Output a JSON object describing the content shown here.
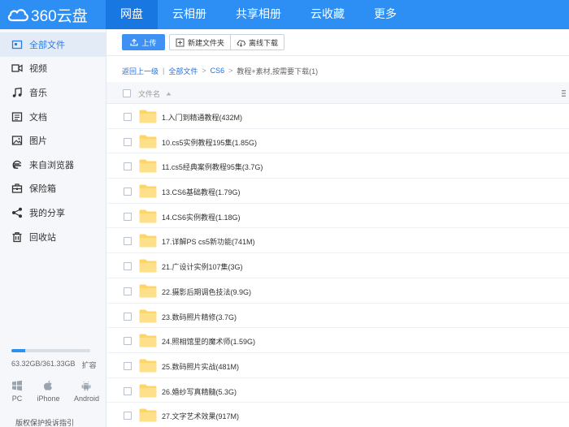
{
  "colors": {
    "accent": "#2d8ff3",
    "folder": "#ffd567"
  },
  "header": {
    "logo_text": "360云盘",
    "nav": [
      {
        "label": "网盘",
        "active": true
      },
      {
        "label": "云相册",
        "active": false
      },
      {
        "label": "共享相册",
        "active": false
      },
      {
        "label": "云收藏",
        "active": false
      },
      {
        "label": "更多",
        "active": false
      }
    ]
  },
  "sidebar": {
    "items": [
      {
        "label": "全部文件",
        "icon": "all-files-icon",
        "active": true
      },
      {
        "label": "视频",
        "icon": "video-icon",
        "active": false
      },
      {
        "label": "音乐",
        "icon": "music-icon",
        "active": false
      },
      {
        "label": "文档",
        "icon": "document-icon",
        "active": false
      },
      {
        "label": "图片",
        "icon": "image-icon",
        "active": false
      },
      {
        "label": "来自浏览器",
        "icon": "browser-icon",
        "active": false
      },
      {
        "label": "保险箱",
        "icon": "safe-icon",
        "active": false
      },
      {
        "label": "我的分享",
        "icon": "share-icon",
        "active": false
      },
      {
        "label": "回收站",
        "icon": "trash-icon",
        "active": false
      }
    ],
    "storage": {
      "text": "63.32GB/361.33GB",
      "used_fraction": 0.175,
      "expand_label": "扩容"
    },
    "clients": [
      {
        "label": "PC",
        "icon": "windows-icon"
      },
      {
        "label": "iPhone",
        "icon": "apple-icon"
      },
      {
        "label": "Android",
        "icon": "android-icon"
      }
    ],
    "report_link": "版权保护投诉指引"
  },
  "toolbar": {
    "upload_label": "上传",
    "new_folder_label": "新建文件夹",
    "offline_download_label": "离线下载"
  },
  "breadcrumb": {
    "back": "返回上一级",
    "root": "全部文件",
    "parent": "CS6",
    "current": "教程+素材,按需要下载(1)"
  },
  "list_header": {
    "name_label": "文件名"
  },
  "files": [
    {
      "name": "1.入门到精通教程(432M)"
    },
    {
      "name": "10.cs5实例教程195集(1.85G)"
    },
    {
      "name": "11.cs5经典案例教程95集(3.7G)"
    },
    {
      "name": "13.CS6基础教程(1.79G)"
    },
    {
      "name": "14.CS6实例教程(1.18G)"
    },
    {
      "name": "17.详解PS cs5新功能(741M)"
    },
    {
      "name": "21.广设计实例107集(3G)"
    },
    {
      "name": "22.摄影后期调色技法(9.9G)"
    },
    {
      "name": "23.数码照片精修(3.7G)"
    },
    {
      "name": "24.照相馆里的魔术师(1.59G)"
    },
    {
      "name": "25.数码照片实战(481M)"
    },
    {
      "name": "26.婚纱写真精髓(5.3G)"
    },
    {
      "name": "27.文字艺术效果(917M)"
    }
  ]
}
